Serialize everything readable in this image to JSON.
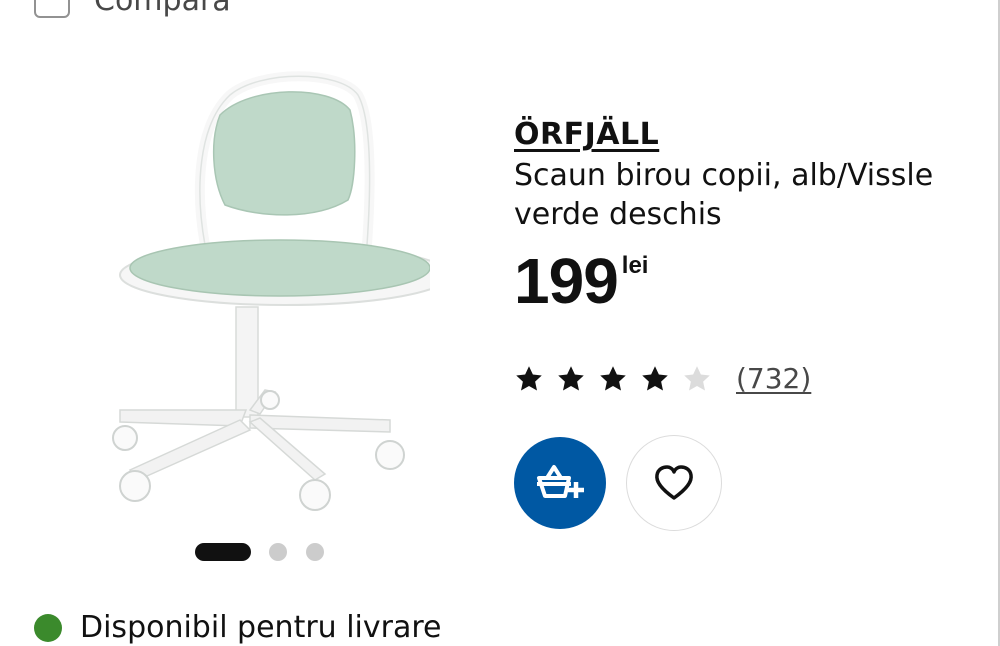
{
  "compare": {
    "label": "Compară"
  },
  "product": {
    "name": "ÖRFJÄLL",
    "description": "Scaun birou copii, alb/Vissle verde deschis",
    "price": {
      "value": "199",
      "currency": "lei"
    },
    "rating": {
      "stars": 4,
      "max": 5,
      "reviews": "(732)"
    },
    "image_alt": "child-desk-chair-image"
  },
  "carousel": {
    "total": 3,
    "active": 1
  },
  "actions": {
    "cart_icon": "add-to-basket-icon",
    "favorite_icon": "heart-icon"
  },
  "availability": {
    "text": "Disponibil pentru livrare",
    "status_color": "#3b8a2c"
  },
  "colors": {
    "accent": "#0058a3",
    "seat": "#bfd9c9",
    "frame": "#ffffff"
  }
}
